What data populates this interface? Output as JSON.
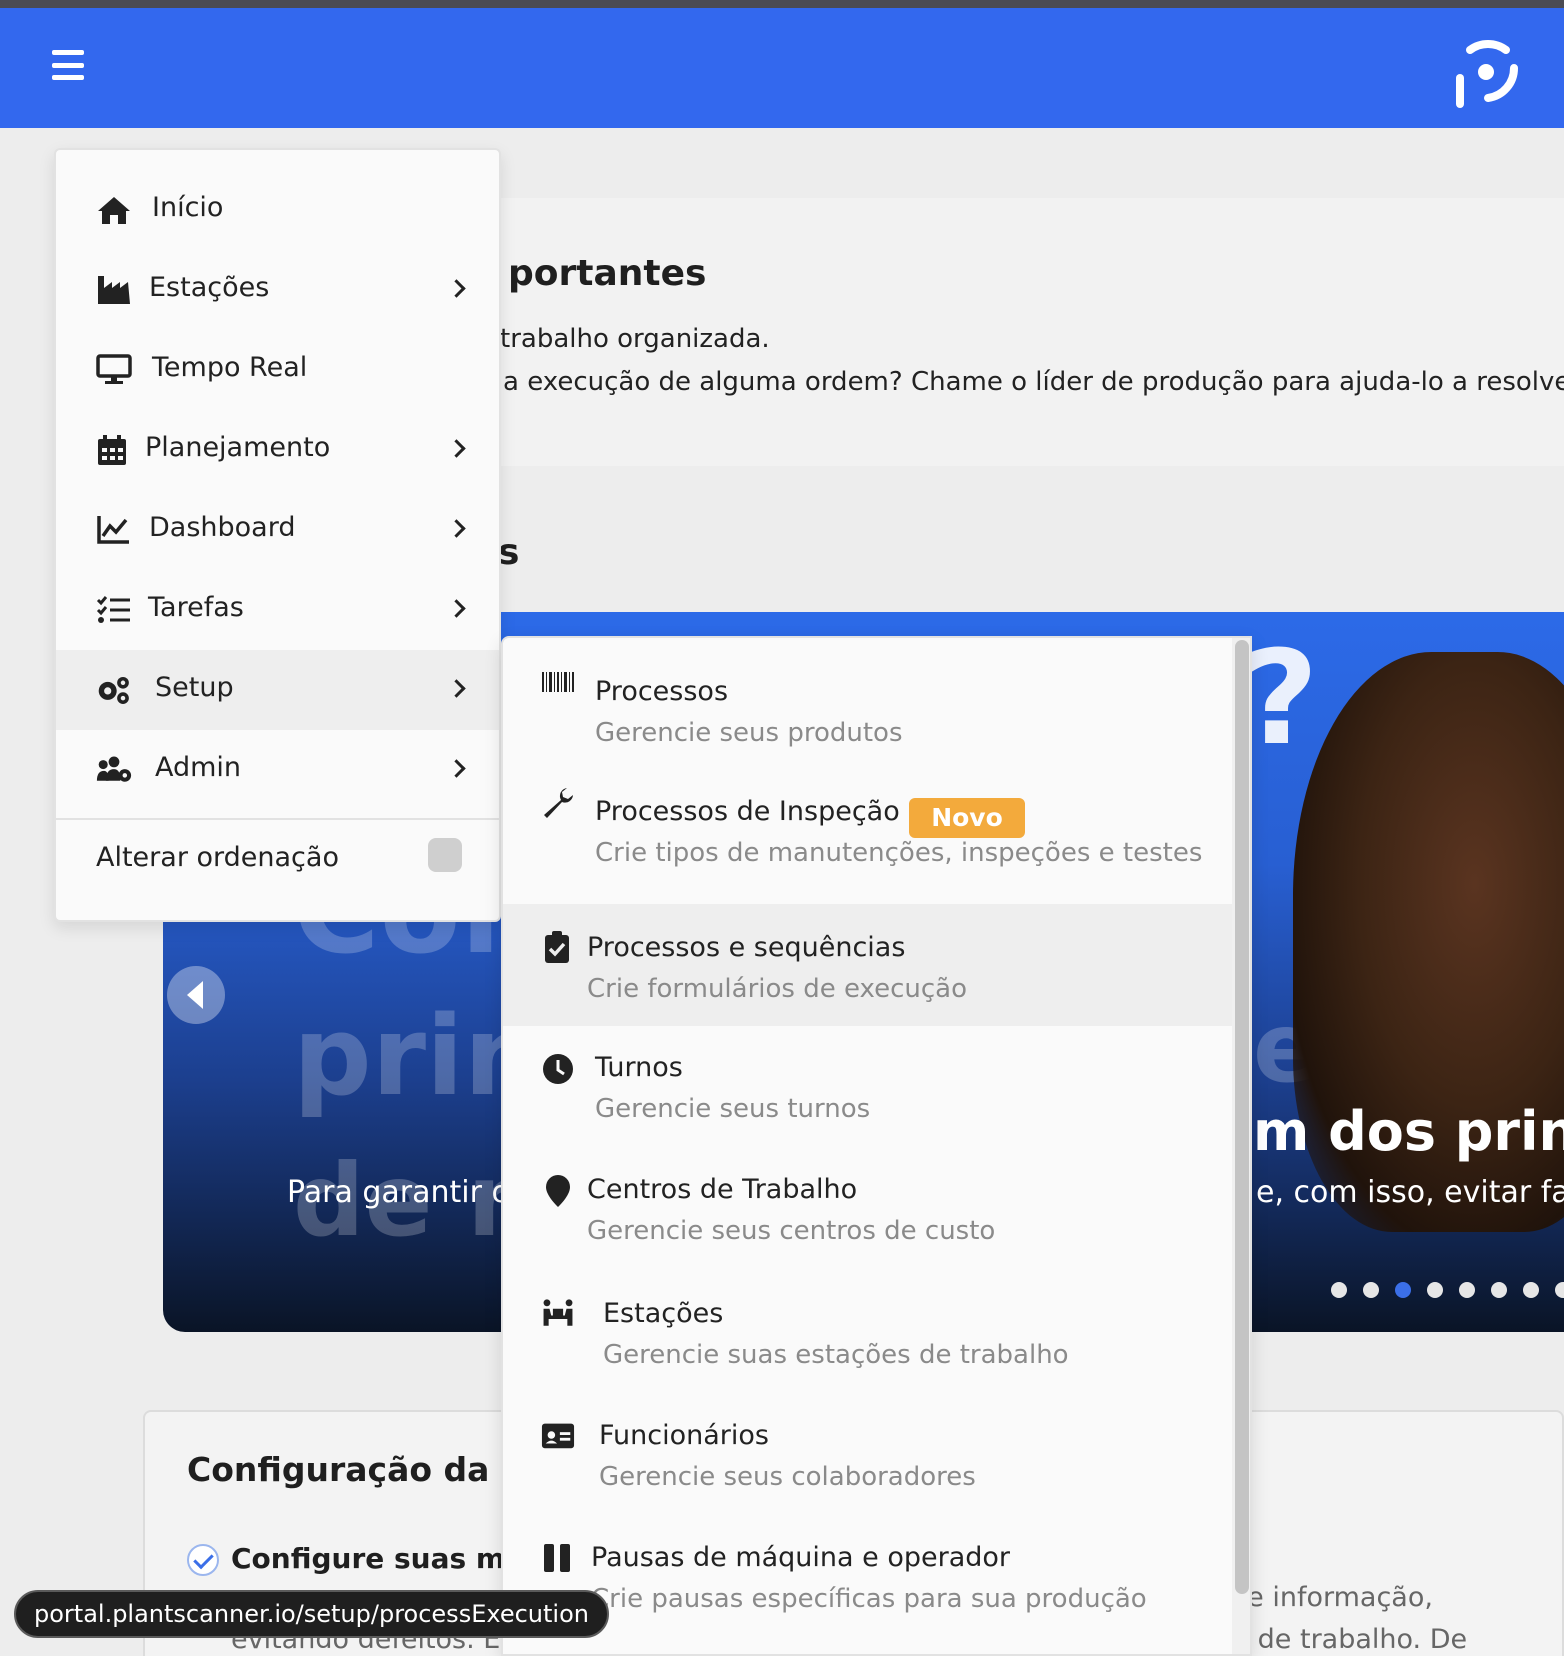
{
  "header": {
    "menu_icon": "hamburger-icon",
    "logo_icon": "plantscanner-logo",
    "brand_color": "#3368ee"
  },
  "notice": {
    "title": "portantes",
    "line1": "trabalho organizada.",
    "line2": "a execução de alguma ordem? Chame o líder de produção para ajuda-lo a resolver"
  },
  "section_heading": "s",
  "carousel": {
    "ghost_line1": "Con",
    "ghost_line2": "princ",
    "ghost_line3": "de m",
    "ghost_right": "es",
    "question_mark": "?",
    "heading": "m dos princi",
    "text_left": "Para garantir o",
    "text_right": "e, com isso, evitar fal",
    "dot_count": 8,
    "active_dot": 3,
    "active_dot_color": "#3b6fe8"
  },
  "setup_card": {
    "title": "Configuração da p",
    "item": "Configure suas métri",
    "desc_line1_right": "de informação,",
    "desc_line2_left": "evitando defeitos. En",
    "desc_line2_right": "s de trabalho. De"
  },
  "sidebar": {
    "items": [
      {
        "label": "Início",
        "icon": "home-icon",
        "has_submenu": false
      },
      {
        "label": "Estações",
        "icon": "industry-icon",
        "has_submenu": true
      },
      {
        "label": "Tempo Real",
        "icon": "monitor-icon",
        "has_submenu": false
      },
      {
        "label": "Planejamento",
        "icon": "calendar-icon",
        "has_submenu": true
      },
      {
        "label": "Dashboard",
        "icon": "chart-line-icon",
        "has_submenu": true
      },
      {
        "label": "Tarefas",
        "icon": "tasks-icon",
        "has_submenu": true
      },
      {
        "label": "Setup",
        "icon": "cogs-icon",
        "has_submenu": true,
        "active": true
      },
      {
        "label": "Admin",
        "icon": "users-cog-icon",
        "has_submenu": true
      }
    ],
    "sort_label": "Alterar ordenação",
    "sort_enabled": false
  },
  "submenu": {
    "items": [
      {
        "title": "Processos",
        "desc": "Gerencie seus produtos",
        "icon": "barcode-icon"
      },
      {
        "title": "Processos de Inspeção",
        "desc": "Crie tipos de manutenções, inspeções e testes",
        "icon": "wrench-icon",
        "badge": "Novo"
      },
      {
        "title": "Processos e sequências",
        "desc": "Crie formulários de execução",
        "icon": "clipboard-check-icon",
        "active": true
      },
      {
        "title": "Turnos",
        "desc": "Gerencie seus turnos",
        "icon": "clock-icon"
      },
      {
        "title": "Centros de Trabalho",
        "desc": "Gerencie seus centros de custo",
        "icon": "map-marker-icon"
      },
      {
        "title": "Estações",
        "desc": "Gerencie suas estações de trabalho",
        "icon": "people-carry-icon"
      },
      {
        "title": "Funcionários",
        "desc": "Gerencie seus colaboradores",
        "icon": "id-card-icon"
      },
      {
        "title": "Pausas de máquina e operador",
        "desc": "Crie pausas específicas para sua produção",
        "icon": "pause-icon"
      }
    ],
    "badge_color": "#f3aa3c"
  },
  "status_url": "portal.plantscanner.io/setup/processExecution"
}
